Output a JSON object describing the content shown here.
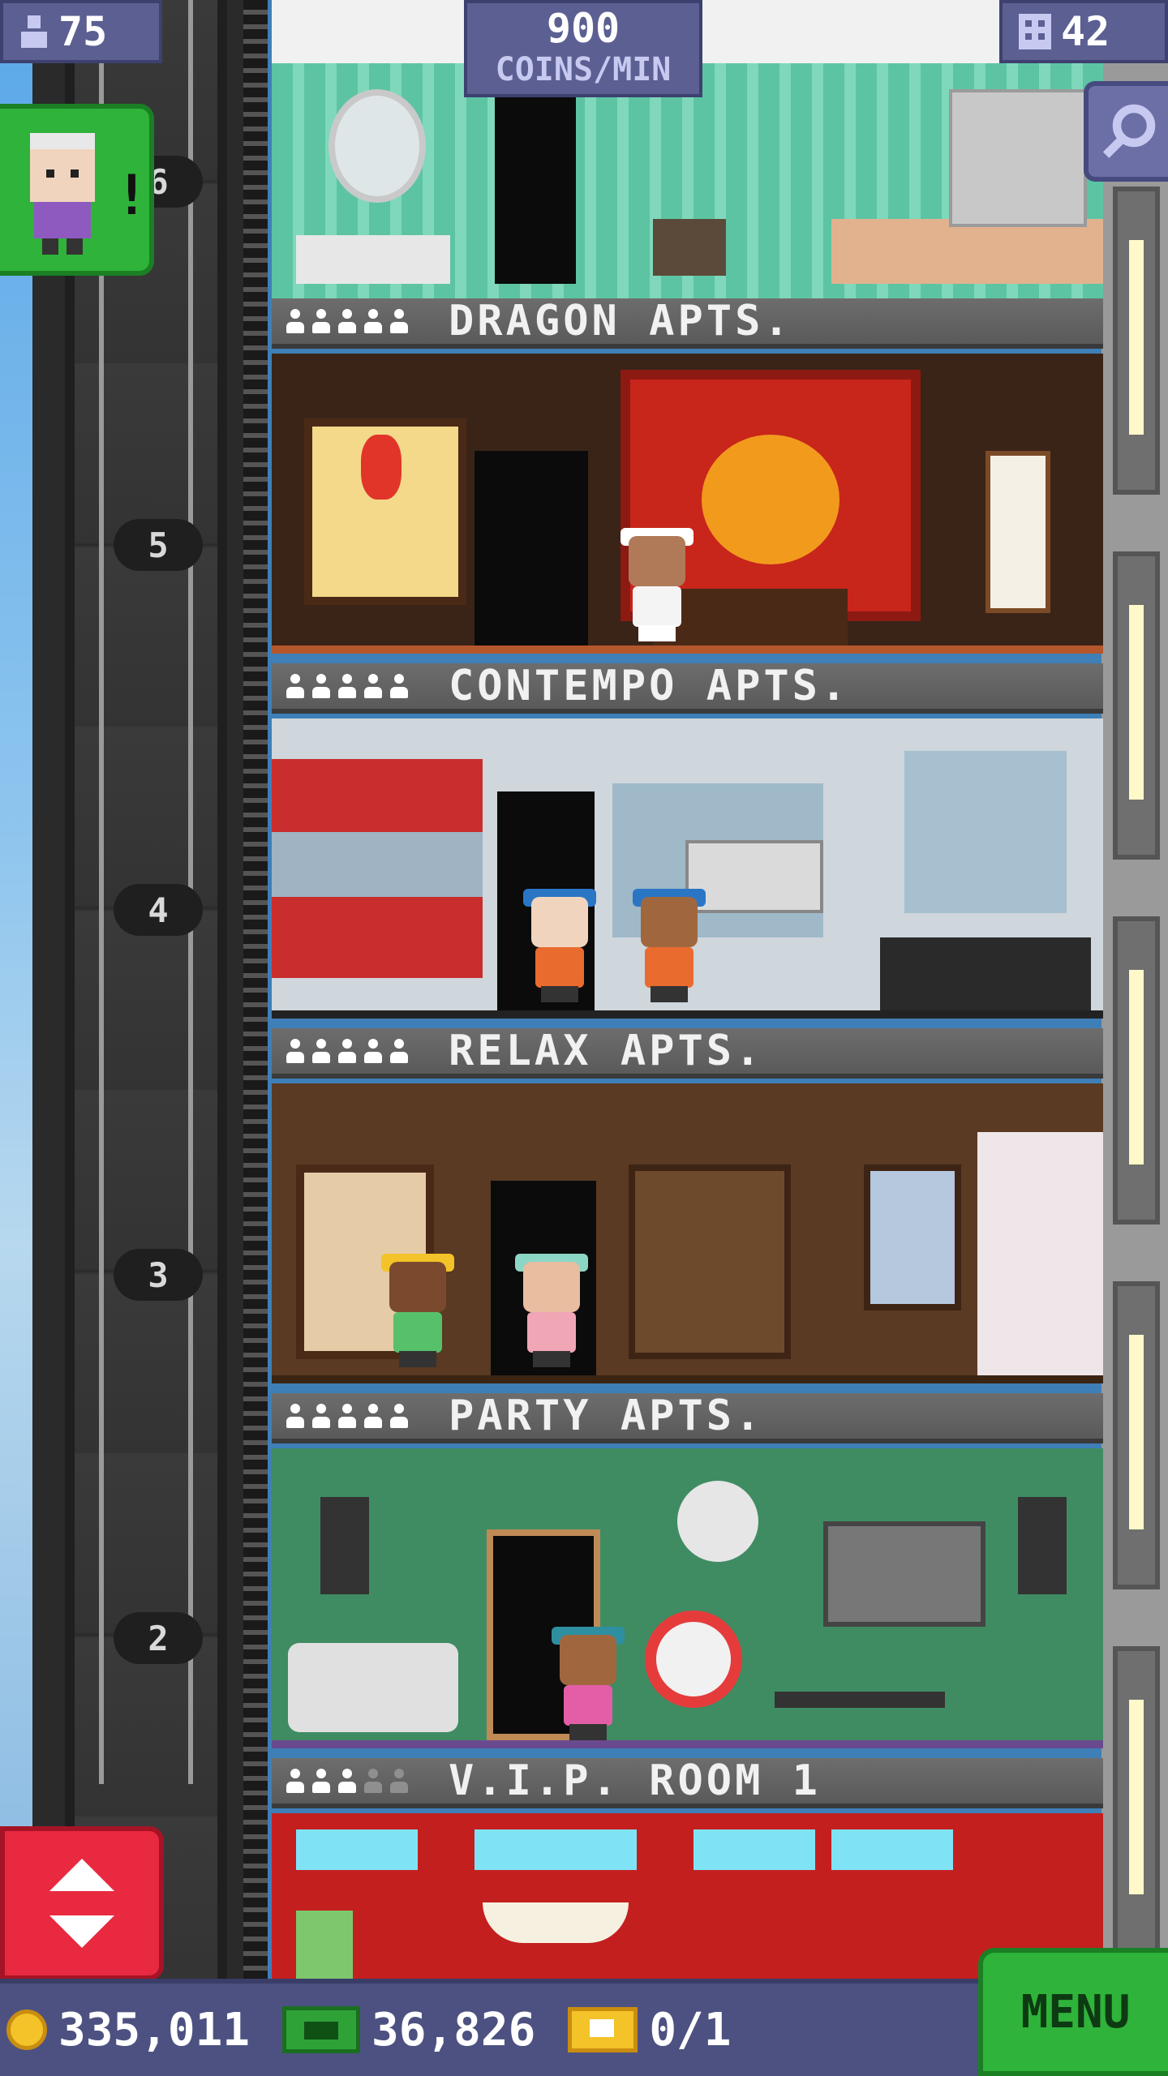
{
  "hud": {
    "population": "75",
    "floors": "42",
    "coins_per_min_value": "900",
    "coins_per_min_unit": "COINS/MIN"
  },
  "floors": [
    {
      "name": "DRAGON APTS.",
      "stars": 5
    },
    {
      "name": "CONTEMPO APTS.",
      "stars": 5
    },
    {
      "name": "RELAX APTS.",
      "stars": 5
    },
    {
      "name": "PARTY APTS.",
      "stars": 5
    },
    {
      "name": "V.I.P. ROOM 1",
      "stars": 3
    }
  ],
  "elevator_floor_numbers": [
    "6",
    "5",
    "4",
    "3",
    "2"
  ],
  "bottom_bar": {
    "coins": "335,011",
    "bux": "36,826",
    "tickets": "0/1",
    "menu_label": "MENU"
  },
  "colors": {
    "hud_bg": "#5b5f92",
    "green_button": "#2fb33a",
    "red_button": "#e8293f"
  },
  "icons": [
    "person-icon",
    "building-icon",
    "magnifier-icon",
    "visitor-avatar-icon",
    "elevator-arrows-icon",
    "coin-icon",
    "bux-icon",
    "ticket-icon"
  ]
}
